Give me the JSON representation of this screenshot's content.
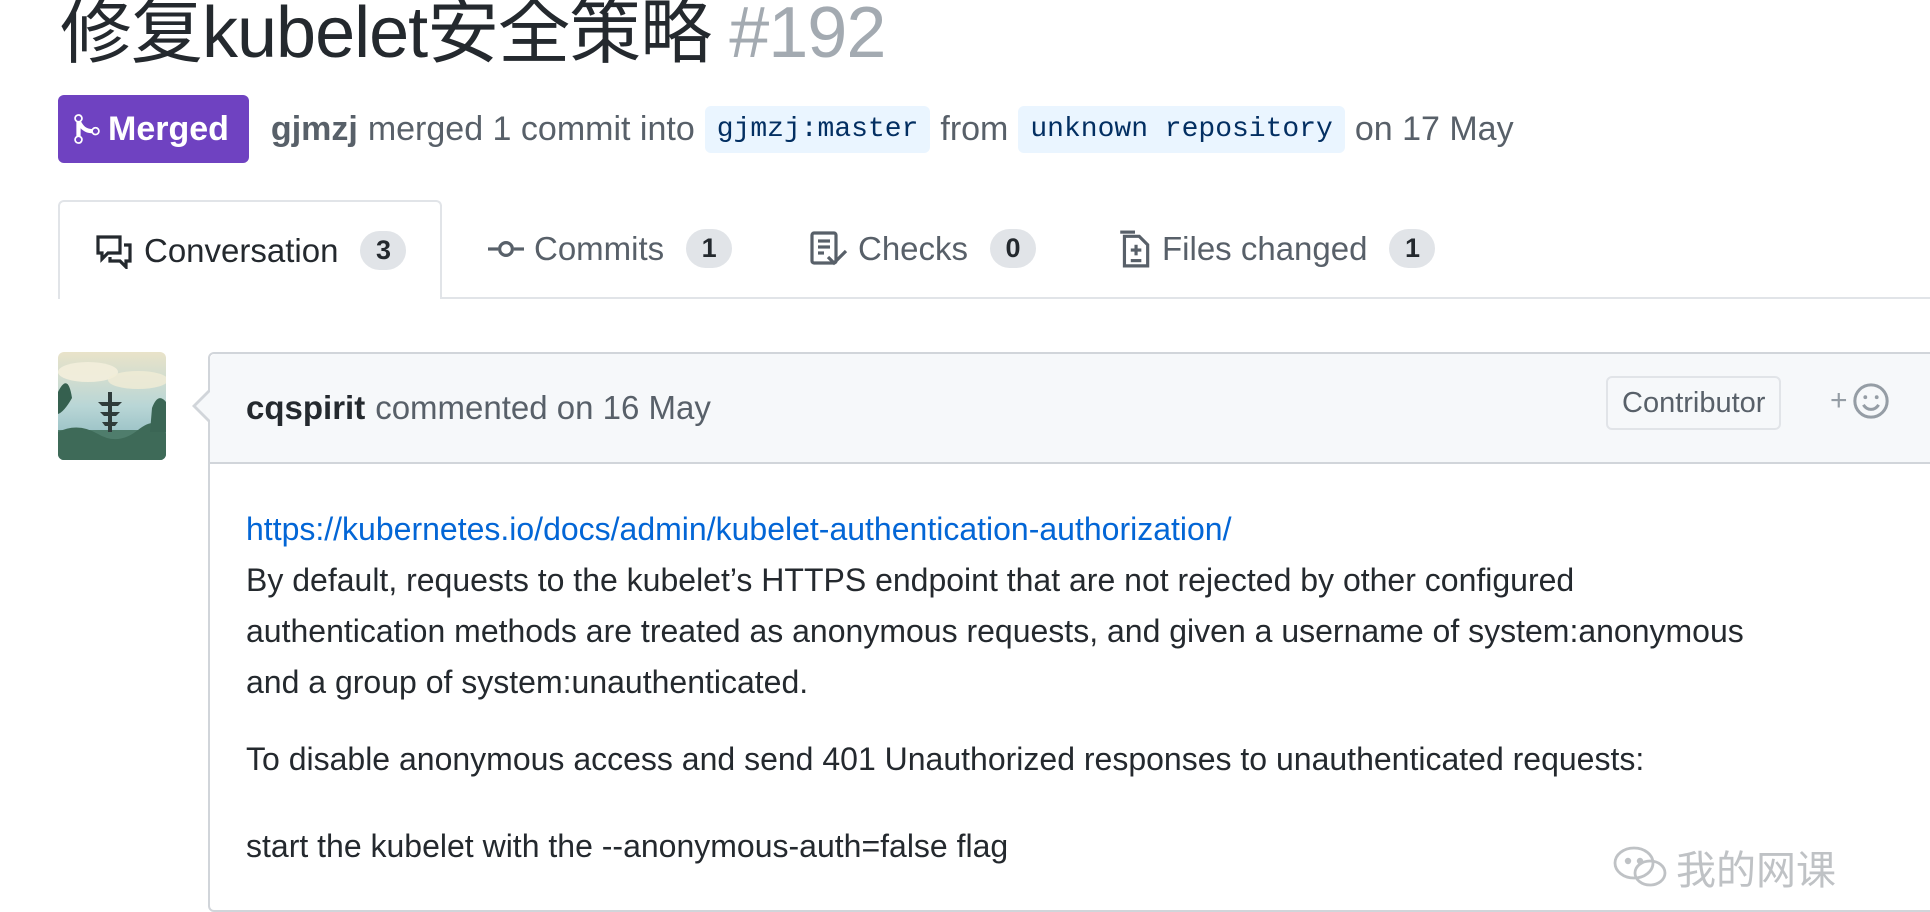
{
  "pr": {
    "title": "修复kubelet安全策略",
    "number": "#192",
    "state": "Merged",
    "author": "gjmzj",
    "action_text": "merged 1 commit into",
    "base_branch": "gjmzj:master",
    "from_text": "from",
    "head_branch": "unknown repository",
    "date_text": "on 17 May"
  },
  "tabs": [
    {
      "label": "Conversation",
      "count": "3",
      "icon": "comment-discussion-icon"
    },
    {
      "label": "Commits",
      "count": "1",
      "icon": "git-commit-icon"
    },
    {
      "label": "Checks",
      "count": "0",
      "icon": "checklist-icon"
    },
    {
      "label": "Files changed",
      "count": "1",
      "icon": "file-diff-icon"
    }
  ],
  "comment": {
    "author": "cqspirit",
    "action": "commented on 16 May",
    "role": "Contributor",
    "reaction_plus": "+",
    "link": "https://kubernetes.io/docs/admin/kubelet-authentication-authorization/",
    "paragraph1": "By default, requests to the kubelet’s HTTPS endpoint that are not rejected by other configured authentication methods are treated as anonymous requests, and given a username of system:anonymous and a group of system:unauthenticated.",
    "paragraph2": "To disable anonymous access and send 401 Unauthorized responses to unauthenticated requests:",
    "paragraph3": "start the kubelet with the --anonymous-auth=false flag"
  },
  "watermark": {
    "text": "我的网课"
  },
  "colors": {
    "merged": "#6f42c1",
    "link": "#0366d6",
    "muted": "#586069",
    "border": "#d1d5da"
  }
}
